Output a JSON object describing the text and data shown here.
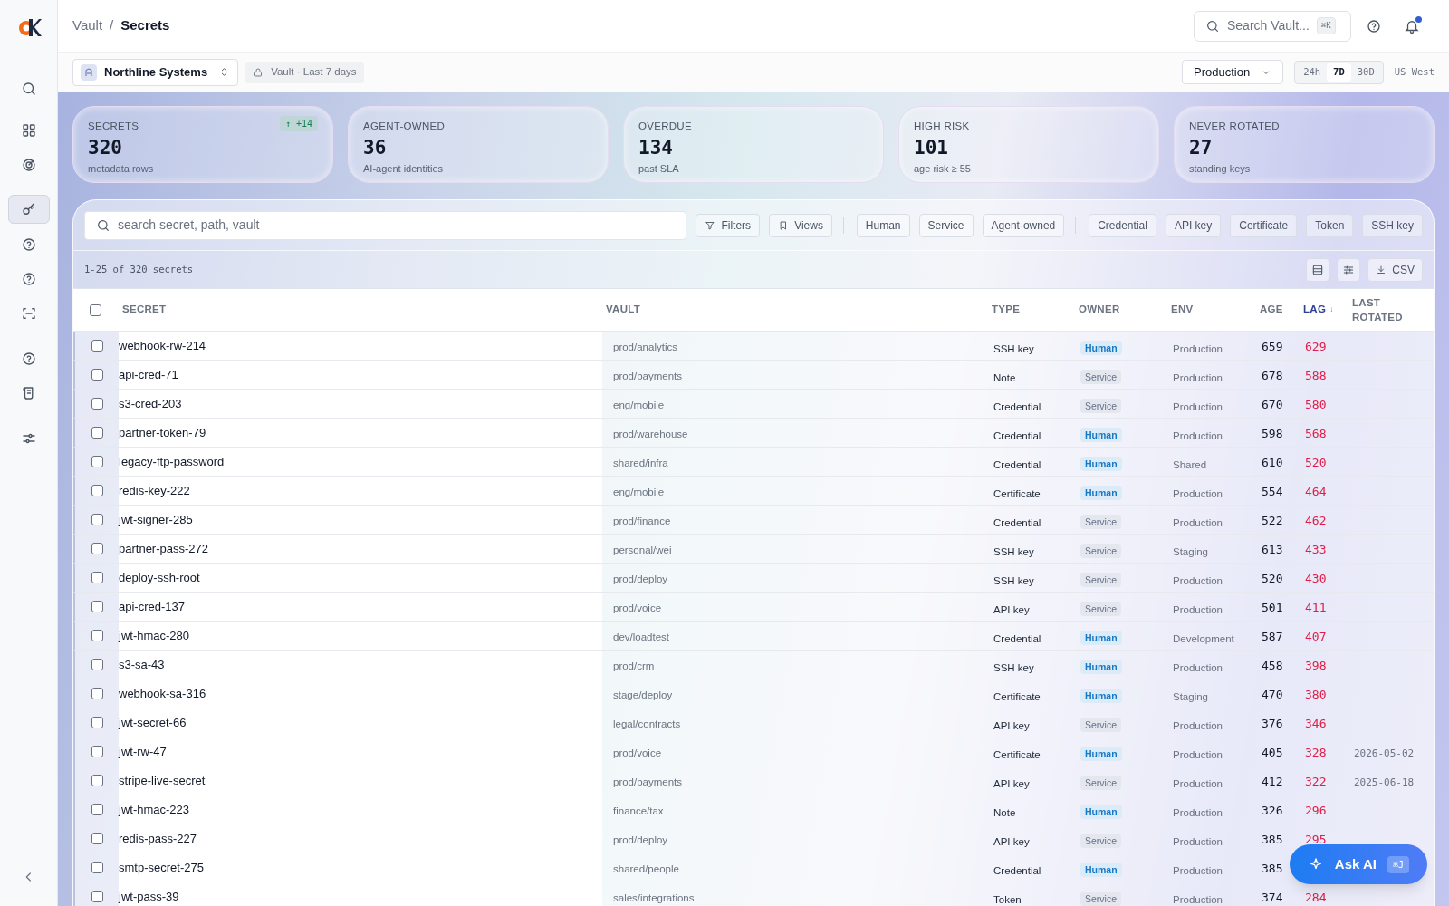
{
  "breadcrumb": {
    "items": [
      "Vault",
      "Secrets"
    ],
    "separator": "/"
  },
  "sidebar": {
    "items": [
      {
        "kind": "search",
        "selected": false
      },
      {
        "kind": "grid",
        "selected": false
      },
      {
        "kind": "radar",
        "selected": false
      },
      {
        "kind": "key",
        "selected": true
      },
      {
        "kind": "help",
        "selected": false
      },
      {
        "kind": "help",
        "selected": false
      },
      {
        "kind": "scan",
        "selected": false
      },
      {
        "kind": "help",
        "selected": false
      },
      {
        "kind": "scroll",
        "selected": false
      },
      {
        "kind": "sliders",
        "selected": false
      }
    ]
  },
  "header": {
    "search": {
      "placeholder": "Search Vault...",
      "shortcut": "⌘K"
    },
    "notifications": {
      "unread": true
    }
  },
  "toolbar": {
    "org": "Northline Systems",
    "scope": "Vault · Last 7 days",
    "environment": "Production",
    "ranges": [
      {
        "label": "24h",
        "selected": false
      },
      {
        "label": "7D",
        "selected": true
      },
      {
        "label": "30D",
        "selected": false
      }
    ],
    "region": "US West"
  },
  "kpis": [
    {
      "label": "SECRETS",
      "value": "320",
      "caption": "metadata rows",
      "delta": "↑ +14"
    },
    {
      "label": "AGENT-OWNED",
      "value": "36",
      "caption": "AI-agent identities"
    },
    {
      "label": "OVERDUE",
      "value": "134",
      "caption": "past SLA"
    },
    {
      "label": "HIGH RISK",
      "value": "101",
      "caption": "age risk ≥ 55"
    },
    {
      "label": "NEVER ROTATED",
      "value": "27",
      "caption": "standing keys"
    }
  ],
  "table": {
    "search": {
      "placeholder": "search secret, path, vault"
    },
    "buttons": [
      {
        "kind": "filter",
        "label": "Filters"
      },
      {
        "kind": "bookmark",
        "label": "Views"
      }
    ],
    "owner_chips": [
      "Human",
      "Service",
      "Agent-owned"
    ],
    "type_chips": [
      "Credential",
      "API key",
      "Certificate",
      "Token",
      "SSH key"
    ],
    "count": "1-25 of 320 secrets",
    "select_all": {
      "checked": false
    },
    "export": "CSV",
    "columns": [
      {
        "label": "SECRET",
        "sorted": false
      },
      {
        "label": "VAULT",
        "sorted": false
      },
      {
        "label": "TYPE",
        "sorted": false
      },
      {
        "label": "OWNER",
        "sorted": false
      },
      {
        "label": "ENV",
        "sorted": false
      },
      {
        "label": "AGE",
        "sorted": false
      },
      {
        "label": "LAG",
        "sorted": true,
        "sort_arrow": "↓"
      },
      {
        "label": "LAST ROTATED",
        "sorted": false
      }
    ],
    "rows": [
      {
        "checked": false,
        "secret": "webhook-rw-214",
        "vault": "prod/analytics",
        "type": "SSH key",
        "owner": {
          "label": "Human",
          "kind": "human"
        },
        "env": "Production",
        "age": "659",
        "lag": "629"
      },
      {
        "checked": false,
        "secret": "api-cred-71",
        "vault": "prod/payments",
        "type": "Note",
        "owner": {
          "label": "Service",
          "kind": "service"
        },
        "env": "Production",
        "age": "678",
        "lag": "588"
      },
      {
        "checked": false,
        "secret": "s3-cred-203",
        "vault": "eng/mobile",
        "type": "Credential",
        "owner": {
          "label": "Service",
          "kind": "service"
        },
        "env": "Production",
        "age": "670",
        "lag": "580"
      },
      {
        "checked": false,
        "secret": "partner-token-79",
        "vault": "prod/warehouse",
        "type": "Credential",
        "owner": {
          "label": "Human",
          "kind": "human"
        },
        "env": "Production",
        "age": "598",
        "lag": "568"
      },
      {
        "checked": false,
        "secret": "legacy-ftp-password",
        "vault": "shared/infra",
        "type": "Credential",
        "owner": {
          "label": "Human",
          "kind": "human"
        },
        "env": "Shared",
        "age": "610",
        "lag": "520"
      },
      {
        "checked": false,
        "secret": "redis-key-222",
        "vault": "eng/mobile",
        "type": "Certificate",
        "owner": {
          "label": "Human",
          "kind": "human"
        },
        "env": "Production",
        "age": "554",
        "lag": "464"
      },
      {
        "checked": false,
        "secret": "jwt-signer-285",
        "vault": "prod/finance",
        "type": "Credential",
        "owner": {
          "label": "Service",
          "kind": "service"
        },
        "env": "Production",
        "age": "522",
        "lag": "462"
      },
      {
        "checked": false,
        "secret": "partner-pass-272",
        "vault": "personal/wei",
        "type": "SSH key",
        "owner": {
          "label": "Service",
          "kind": "service"
        },
        "env": "Staging",
        "age": "613",
        "lag": "433"
      },
      {
        "checked": false,
        "secret": "deploy-ssh-root",
        "vault": "prod/deploy",
        "type": "SSH key",
        "owner": {
          "label": "Service",
          "kind": "service"
        },
        "env": "Production",
        "age": "520",
        "lag": "430"
      },
      {
        "checked": false,
        "secret": "api-cred-137",
        "vault": "prod/voice",
        "type": "API key",
        "owner": {
          "label": "Service",
          "kind": "service"
        },
        "env": "Production",
        "age": "501",
        "lag": "411"
      },
      {
        "checked": false,
        "secret": "jwt-hmac-280",
        "vault": "dev/loadtest",
        "type": "Credential",
        "owner": {
          "label": "Human",
          "kind": "human"
        },
        "env": "Development",
        "age": "587",
        "lag": "407"
      },
      {
        "checked": false,
        "secret": "s3-sa-43",
        "vault": "prod/crm",
        "type": "SSH key",
        "owner": {
          "label": "Human",
          "kind": "human"
        },
        "env": "Production",
        "age": "458",
        "lag": "398"
      },
      {
        "checked": false,
        "secret": "webhook-sa-316",
        "vault": "stage/deploy",
        "type": "Certificate",
        "owner": {
          "label": "Human",
          "kind": "human"
        },
        "env": "Staging",
        "age": "470",
        "lag": "380"
      },
      {
        "checked": false,
        "secret": "jwt-secret-66",
        "vault": "legal/contracts",
        "type": "API key",
        "owner": {
          "label": "Service",
          "kind": "service"
        },
        "env": "Production",
        "age": "376",
        "lag": "346"
      },
      {
        "checked": false,
        "secret": "jwt-rw-47",
        "vault": "prod/voice",
        "type": "Certificate",
        "owner": {
          "label": "Human",
          "kind": "human"
        },
        "env": "Production",
        "age": "405",
        "lag": "328",
        "last_rotated": "2026-05-02"
      },
      {
        "checked": false,
        "secret": "stripe-live-secret",
        "vault": "prod/payments",
        "type": "API key",
        "owner": {
          "label": "Service",
          "kind": "service"
        },
        "env": "Production",
        "age": "412",
        "lag": "322",
        "last_rotated": "2025-06-18"
      },
      {
        "checked": false,
        "secret": "jwt-hmac-223",
        "vault": "finance/tax",
        "type": "Note",
        "owner": {
          "label": "Human",
          "kind": "human"
        },
        "env": "Production",
        "age": "326",
        "lag": "296"
      },
      {
        "checked": false,
        "secret": "redis-pass-227",
        "vault": "prod/deploy",
        "type": "API key",
        "owner": {
          "label": "Service",
          "kind": "service"
        },
        "env": "Production",
        "age": "385",
        "lag": "295"
      },
      {
        "checked": false,
        "secret": "smtp-secret-275",
        "vault": "shared/people",
        "type": "Credential",
        "owner": {
          "label": "Human",
          "kind": "human"
        },
        "env": "Production",
        "age": "385"
      },
      {
        "checked": false,
        "secret": "jwt-pass-39",
        "vault": "sales/integrations",
        "type": "Token",
        "owner": {
          "label": "Service",
          "kind": "service"
        },
        "env": "Production",
        "age": "374",
        "lag": "284"
      }
    ]
  },
  "ask_ai": {
    "label": "Ask AI",
    "shortcut": "⌘J"
  }
}
